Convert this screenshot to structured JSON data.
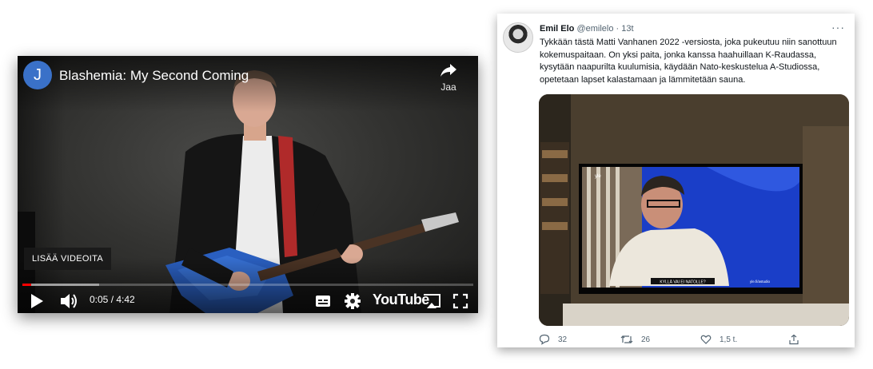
{
  "video": {
    "channel_initial": "J",
    "title": "Blashemia: My Second Coming",
    "share_label": "Jaa",
    "more_videos_label": "LISÄÄ VIDEOITA",
    "current_time": "0:05",
    "duration": "4:42",
    "time_display": "0:05 / 4:42",
    "played_fraction": 0.02,
    "buffered_fraction": 0.17,
    "youtube_logo": "YouTube",
    "icons": [
      "share-icon",
      "play-icon",
      "volume-icon",
      "subtitles-icon",
      "settings-gear-icon",
      "cast-icon",
      "fullscreen-icon"
    ],
    "colors": {
      "progress": "#ff0000",
      "avatar": "#3a71c8"
    }
  },
  "tweet": {
    "author_name": "Emil Elo",
    "author_handle": "@emilelo",
    "separator": "·",
    "time": "13t",
    "more_icon": "more-dots-icon",
    "text": "Tykkään tästä Matti Vanhanen 2022 -versiosta, joka pukeutuu niin sanottuun kokemuspaitaan. On yksi paita, jonka kanssa haahuillaan K-Raudassa, kysytään naapurilta kuulumisia, käydään Nato-keskustelua A-Studiossa, opetetaan lapset kalastamaan ja lämmitetään sauna.",
    "media": {
      "tv_caption": "KYLLÄ VAI EI NATOLLE?",
      "tv_corner": "yle.fi/astudio",
      "tv_logo": "yle"
    },
    "actions": {
      "replies": "32",
      "retweets": "26",
      "likes": "1,5 t."
    }
  }
}
